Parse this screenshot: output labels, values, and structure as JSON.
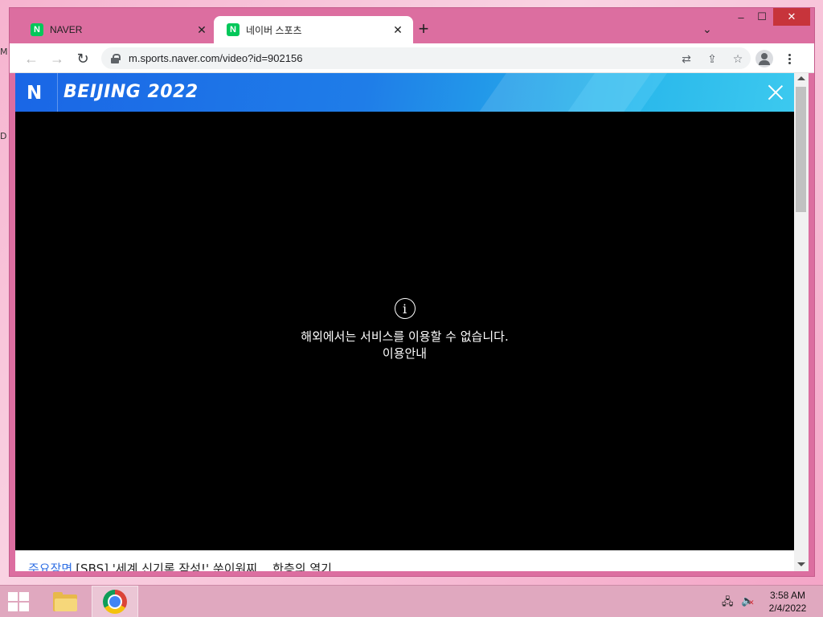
{
  "desktop": {
    "edge_letters": [
      "M",
      "D"
    ]
  },
  "browser": {
    "tabs": [
      {
        "title": "NAVER",
        "favicon": "N",
        "active": false
      },
      {
        "title": "네이버 스포츠",
        "favicon": "N",
        "active": true
      }
    ],
    "new_tab_symbol": "+",
    "url": "m.sports.naver.com/video?id=902156",
    "window_controls": {
      "minimize": "–",
      "maximize": "☐",
      "close": "✕"
    }
  },
  "page": {
    "banner": {
      "logo": "N",
      "event_title": "BEIJING 2022"
    },
    "notice": {
      "message": "해외에서는 서비스를 이용할 수 없습니다.",
      "link": "이용안내"
    },
    "headline": {
      "tag": "주요장면",
      "text": "[SBS] '세계 신기록 작성!' 쑨이원찌... 한층의 열기"
    }
  },
  "taskbar": {
    "time": "3:58 AM",
    "date": "2/4/2022"
  }
}
